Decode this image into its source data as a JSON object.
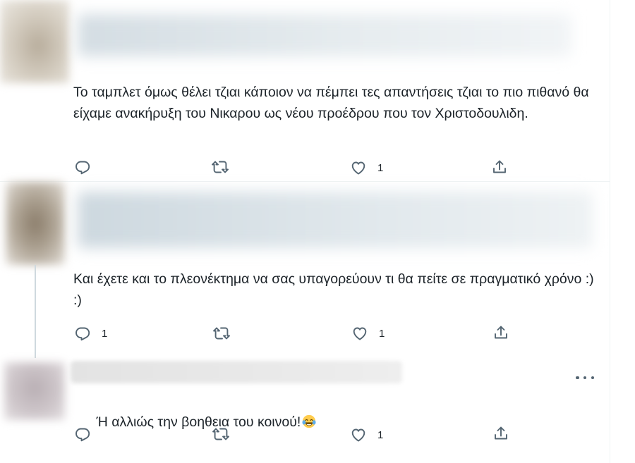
{
  "tweets": [
    {
      "text": "Το ταμπλετ όμως θέλει τζιαι κάποιον να πέμπει τες απαντήσεις τζιαι το πιο πιθανό θα είχαμε ανακήρυξη του Νικαρου ως νέου προέδρου που τον Χριστοδουλιδη.",
      "replies": "",
      "retweets": "",
      "likes": "1"
    },
    {
      "text": "Και έχετε και το πλεονέκτημα να σας υπαγορεύουν τι θα πείτε σε πραγματικό χρόνο :) :)",
      "replies": "1",
      "retweets": "",
      "likes": "1"
    },
    {
      "text": "Ή αλλιώς την βοηθεια του κοινού!",
      "emoji": "face-with-tears-of-joy",
      "replies": "",
      "retweets": "",
      "likes": "1"
    }
  ],
  "icons": {
    "reply": "reply-icon",
    "retweet": "retweet-icon",
    "like": "heart-icon",
    "share": "share-icon",
    "more": "more-icon"
  },
  "colors": {
    "icon": "#536471",
    "text": "#0f1419",
    "divider": "#eff3f4",
    "thread_line": "#cfd9de"
  }
}
